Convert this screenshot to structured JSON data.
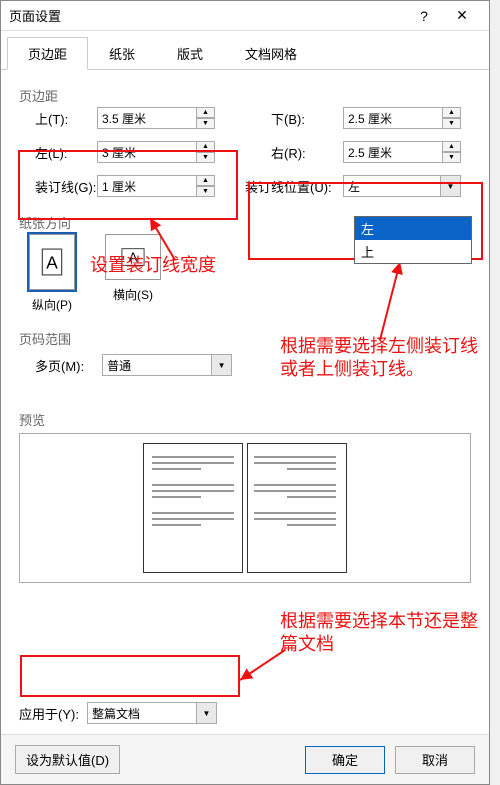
{
  "window": {
    "title": "页面设置",
    "help_icon": "?",
    "close_icon": "✕"
  },
  "tabs": {
    "t0": "页边距",
    "t1": "纸张",
    "t2": "版式",
    "t3": "文档网格"
  },
  "margins": {
    "section": "页边距",
    "top_label": "上(T):",
    "top_value": "3.5 厘米",
    "bottom_label": "下(B):",
    "bottom_value": "2.5 厘米",
    "left_label": "左(L):",
    "left_value": "3 厘米",
    "right_label": "右(R):",
    "right_value": "2.5 厘米",
    "gutter_label": "装订线(G):",
    "gutter_value": "1 厘米",
    "gutter_pos_label": "装订线位置(U):",
    "gutter_pos_value": "左",
    "gutter_pos_options": {
      "o0": "左",
      "o1": "上"
    }
  },
  "orientation": {
    "section": "纸张方向",
    "portrait": "纵向(P)",
    "landscape": "横向(S)"
  },
  "pages": {
    "section": "页码范围",
    "multi_label": "多页(M):",
    "multi_value": "普通"
  },
  "preview": {
    "section": "预览"
  },
  "apply": {
    "label": "应用于(Y):",
    "value": "整篇文档"
  },
  "footer": {
    "default": "设为默认值(D)",
    "ok": "确定",
    "cancel": "取消"
  },
  "annotations": {
    "a1": "设置装订线宽度",
    "a2": "根据需要选择左侧装订线或者上侧装订线。",
    "a3": "根据需要选择本节还是整篇文档"
  }
}
